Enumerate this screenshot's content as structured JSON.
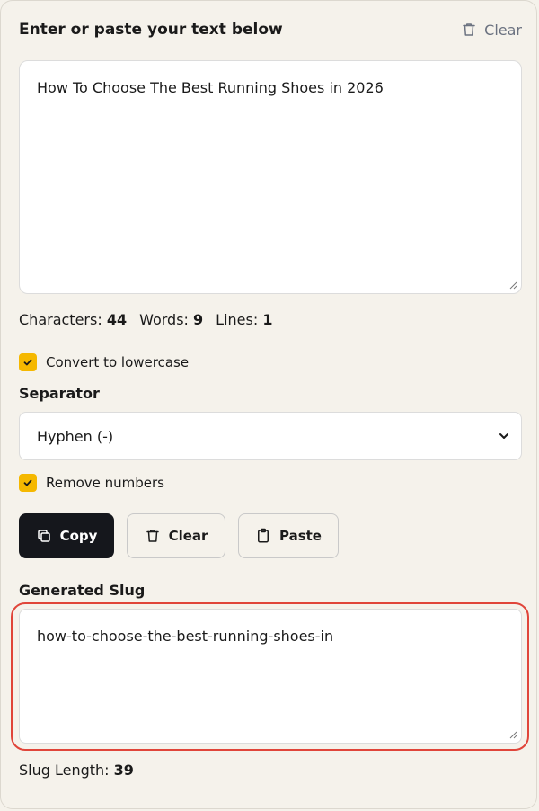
{
  "header": {
    "title": "Enter or paste your text below",
    "clear_label": "Clear"
  },
  "input": {
    "value": "How To Choose The Best Running Shoes in 2026"
  },
  "stats": {
    "characters_label": "Characters:",
    "characters_value": "44",
    "words_label": "Words:",
    "words_value": "9",
    "lines_label": "Lines:",
    "lines_value": "1"
  },
  "options": {
    "lowercase_label": "Convert to lowercase",
    "lowercase_checked": true,
    "separator_label": "Separator",
    "separator_selected": "Hyphen (-)",
    "remove_numbers_label": "Remove numbers",
    "remove_numbers_checked": true
  },
  "actions": {
    "copy_label": "Copy",
    "clear_label": "Clear",
    "paste_label": "Paste"
  },
  "output": {
    "title": "Generated Slug",
    "value": "how-to-choose-the-best-running-shoes-in",
    "length_label": "Slug Length:",
    "length_value": "39"
  },
  "colors": {
    "accent_checkbox": "#f5b800",
    "highlight_outline": "#e0453a",
    "primary_button": "#15171c"
  }
}
